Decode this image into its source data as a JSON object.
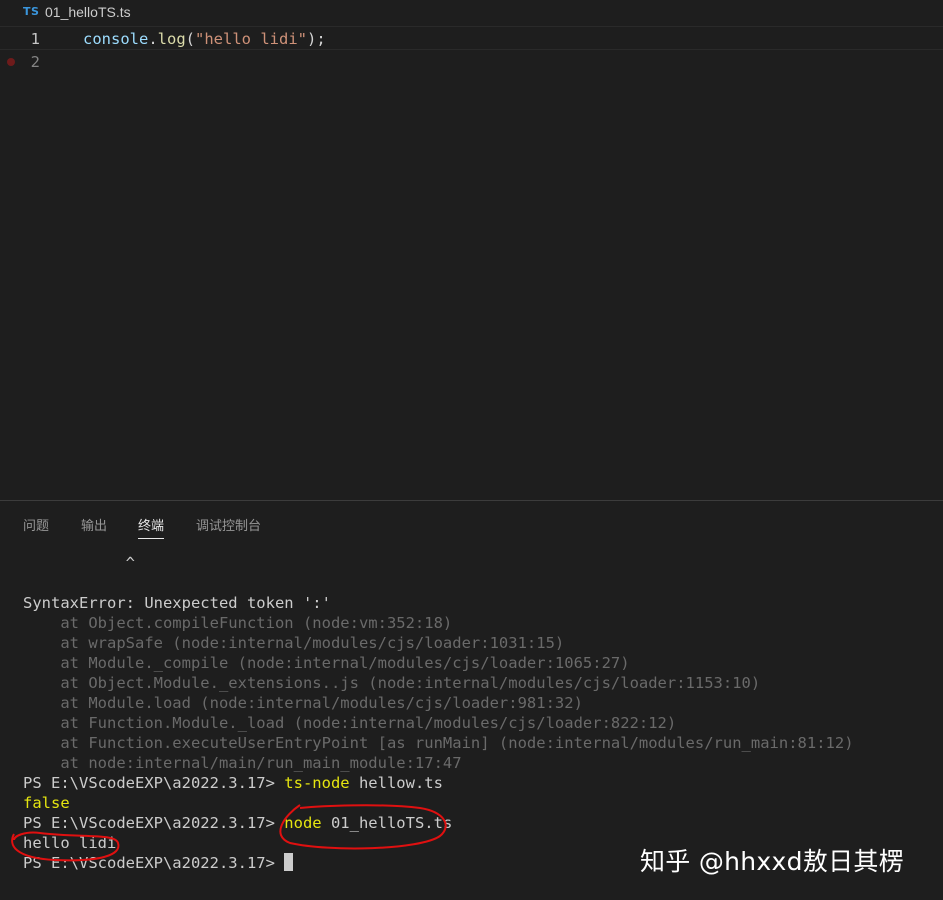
{
  "editor": {
    "tab": {
      "icon": "typescript-file-icon",
      "icon_label": "TS",
      "filename": "01_helloTS.ts"
    },
    "lines": [
      {
        "number": "1",
        "tokens": {
          "object": "console",
          "dot": ".",
          "method": "log",
          "open": "(",
          "string": "\"hello lidi\"",
          "close": ");"
        }
      },
      {
        "number": "2"
      }
    ]
  },
  "panel": {
    "tabs": [
      {
        "label": "问题",
        "active": false
      },
      {
        "label": "输出",
        "active": false
      },
      {
        "label": "终端",
        "active": true
      },
      {
        "label": "调试控制台",
        "active": false
      }
    ]
  },
  "terminal": {
    "caret_line": "           ^",
    "error": "SyntaxError: Unexpected token ':'",
    "stack": [
      "    at Object.compileFunction (node:vm:352:18)",
      "    at wrapSafe (node:internal/modules/cjs/loader:1031:15)",
      "    at Module._compile (node:internal/modules/cjs/loader:1065:27)",
      "    at Object.Module._extensions..js (node:internal/modules/cjs/loader:1153:10)",
      "    at Module.load (node:internal/modules/cjs/loader:981:32)",
      "    at Function.Module._load (node:internal/modules/cjs/loader:822:12)",
      "    at Function.executeUserEntryPoint [as runMain] (node:internal/modules/run_main:81:12)",
      "    at node:internal/main/run_main_module:17:47"
    ],
    "prompt": "PS E:\\VScodeEXP\\a2022.3.17> ",
    "cmd1": {
      "program": "ts-node",
      "args": " hellow.ts"
    },
    "output1": "false",
    "cmd2": {
      "program": "node",
      "args": " 01_helloTS.ts"
    },
    "output2": "hello lidi"
  },
  "watermark": "知乎 @hhxxd敖日其楞",
  "colors": {
    "background": "#1e1e1e",
    "annotation_red": "#e01010",
    "command_yellow": "#e5e510",
    "ts_blue": "#3a96dd"
  }
}
